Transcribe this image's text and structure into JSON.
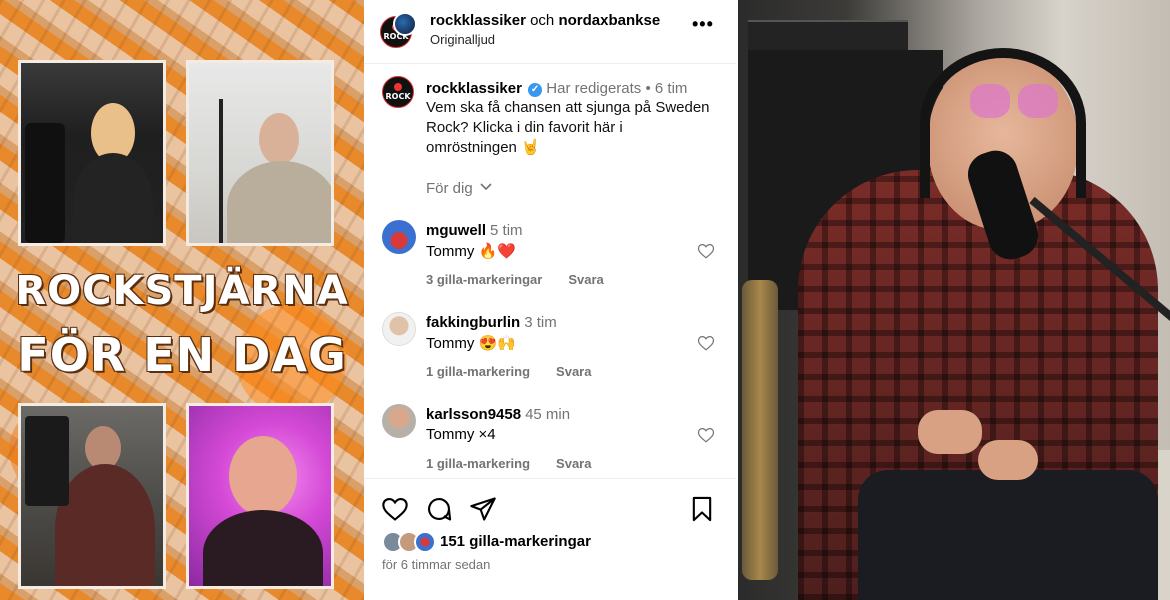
{
  "poster": {
    "line1": "ROCKSTJÄRNA",
    "line2": "FÖR EN DAG"
  },
  "post": {
    "header": {
      "user1": "rockklassiker",
      "connector": "och",
      "user2": "nordaxbankse",
      "audio": "Originalljud",
      "more_label": "•••"
    },
    "avatar_text": "ROCK",
    "caption": {
      "user": "rockklassiker",
      "edited": "Har redigerats",
      "separator": "•",
      "time": "6 tim",
      "text": "Vem ska få chansen att sjunga på Sweden Rock? Klicka i din favorit här i omröstningen 🤘"
    },
    "filter_label": "För dig",
    "comments": [
      {
        "user": "mguwell",
        "time": "5 tim",
        "text": "Tommy 🔥❤️",
        "likes": "3 gilla-markeringar",
        "reply": "Svara"
      },
      {
        "user": "fakkingburlin",
        "time": "3 tim",
        "text": "Tommy 😍🙌",
        "likes": "1 gilla-markering",
        "reply": "Svara"
      },
      {
        "user": "karlsson9458",
        "time": "45 min",
        "text": "Tommy ×4",
        "likes": "1 gilla-markering",
        "reply": "Svara"
      }
    ],
    "likes_total": "151 gilla-markeringar",
    "posted": "för 6 timmar sedan"
  },
  "icons": {
    "like": "heart-icon",
    "comment": "comment-icon",
    "share": "send-icon",
    "save": "bookmark-icon",
    "more": "more-options-icon",
    "chevron": "chevron-down-icon",
    "verified": "verified-badge-icon"
  },
  "colors": {
    "verified": "#3897f0",
    "muted": "#737373",
    "border": "#efefef"
  }
}
